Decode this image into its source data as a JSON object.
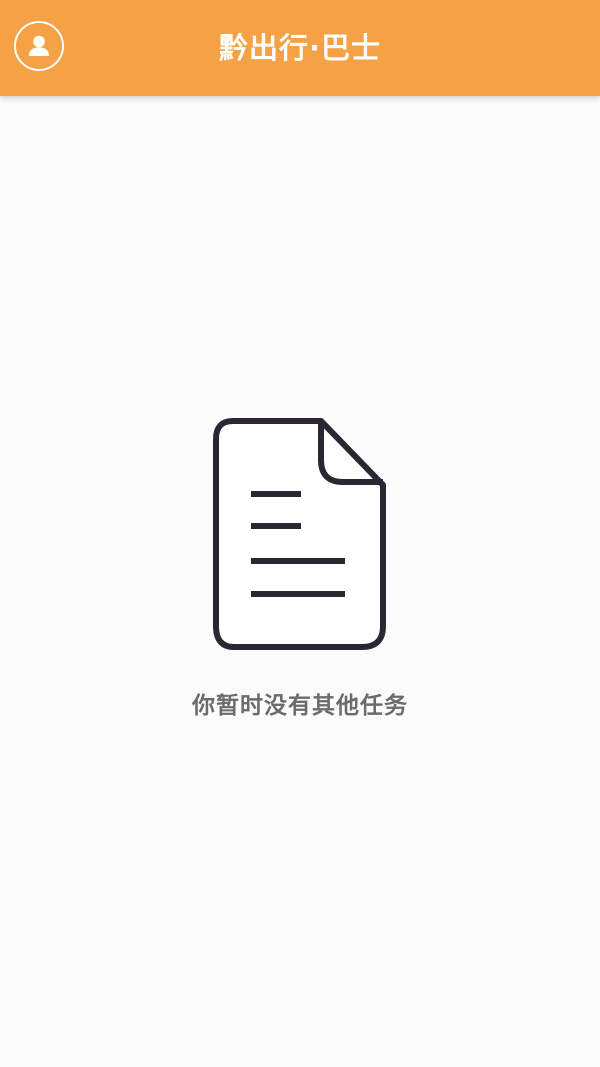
{
  "header": {
    "title": "黔出行·巴士",
    "avatar_icon": "user-avatar-icon",
    "background_color": "#f5a145",
    "text_color": "#ffffff"
  },
  "empty_state": {
    "icon": "document-icon",
    "message": "你暂时没有其他任务",
    "icon_color": "#2a2733",
    "message_color": "#6b6b6b"
  }
}
